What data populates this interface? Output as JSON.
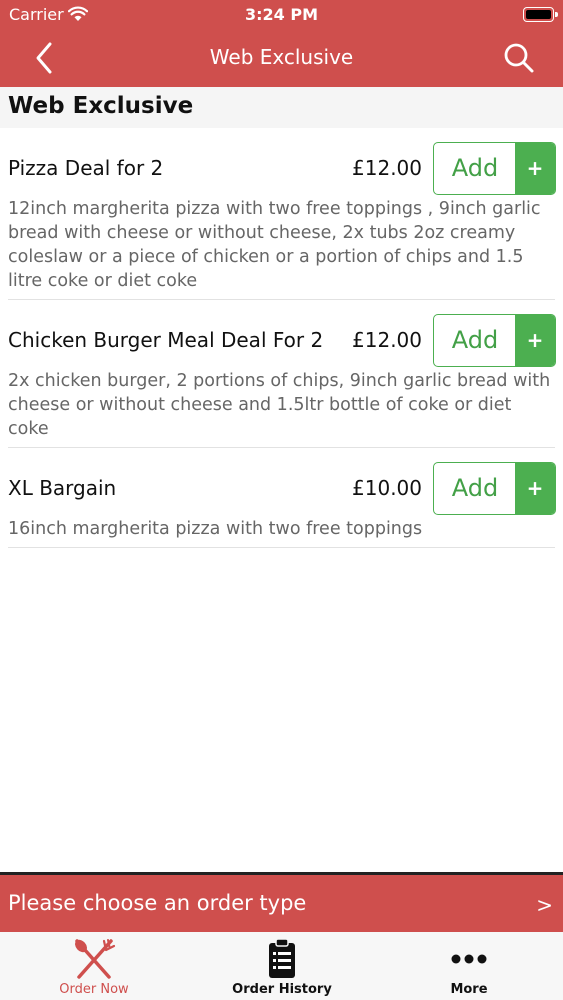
{
  "status_bar": {
    "carrier": "Carrier",
    "time": "3:24 PM"
  },
  "nav": {
    "title": "Web Exclusive",
    "back_icon": "chevron-left-icon",
    "search_icon": "search-icon"
  },
  "section": {
    "title": "Web Exclusive"
  },
  "items": [
    {
      "name": "Pizza Deal for 2",
      "price": "£12.00",
      "add_label": "Add",
      "plus_label": "+",
      "description": "12inch margherita pizza with two free toppings , 9inch garlic bread with cheese or without cheese, 2x tubs 2oz creamy coleslaw or a piece of chicken or a portion of chips and 1.5 litre coke or diet coke"
    },
    {
      "name": "Chicken Burger Meal Deal For 2",
      "price": "£12.00",
      "add_label": "Add",
      "plus_label": "+",
      "description": "2x chicken burger, 2 portions of chips, 9inch garlic bread with cheese or without cheese and 1.5ltr bottle of coke or diet coke"
    },
    {
      "name": "XL Bargain",
      "price": "£10.00",
      "add_label": "Add",
      "plus_label": "+",
      "description": "16inch margherita pizza with two free toppings"
    }
  ],
  "order_banner": {
    "text": "Please choose an order type",
    "arrow": ">"
  },
  "tabs": [
    {
      "label": "Order Now",
      "icon": "fork-knife-icon",
      "active": true
    },
    {
      "label": "Order History",
      "icon": "clipboard-list-icon",
      "active": false
    },
    {
      "label": "More",
      "icon": "more-dots-icon",
      "active": false
    }
  ],
  "colors": {
    "brand_red": "#cf4f4d",
    "add_green": "#4caf50"
  }
}
